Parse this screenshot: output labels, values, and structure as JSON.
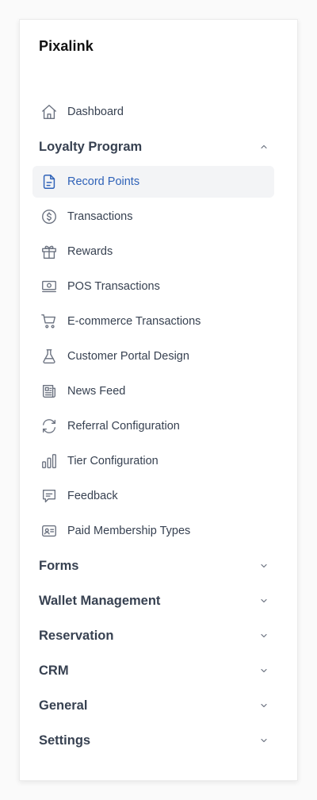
{
  "brand": "Pixalink",
  "dashboard": {
    "label": "Dashboard",
    "icon": "home-icon"
  },
  "sections": [
    {
      "label": "Loyalty Program",
      "expanded": true
    },
    {
      "label": "Forms",
      "expanded": false
    },
    {
      "label": "Wallet Management",
      "expanded": false
    },
    {
      "label": "Reservation",
      "expanded": false
    },
    {
      "label": "CRM",
      "expanded": false
    },
    {
      "label": "General",
      "expanded": false
    },
    {
      "label": "Settings",
      "expanded": false
    }
  ],
  "loyalty_items": [
    {
      "label": "Record Points",
      "icon": "document-icon",
      "active": true
    },
    {
      "label": "Transactions",
      "icon": "dollar-circle-icon"
    },
    {
      "label": "Rewards",
      "icon": "gift-icon"
    },
    {
      "label": "POS Transactions",
      "icon": "cash-icon"
    },
    {
      "label": "E-commerce Transactions",
      "icon": "cart-icon"
    },
    {
      "label": "Customer Portal Design",
      "icon": "beaker-icon"
    },
    {
      "label": "News Feed",
      "icon": "newspaper-icon"
    },
    {
      "label": "Referral Configuration",
      "icon": "refresh-icon"
    },
    {
      "label": "Tier Configuration",
      "icon": "bar-chart-icon"
    },
    {
      "label": "Feedback",
      "icon": "chat-icon"
    },
    {
      "label": "Paid Membership Types",
      "icon": "id-card-icon"
    }
  ],
  "colors": {
    "active_text": "#2f62b8",
    "active_bg": "#f3f4f6",
    "text": "#374151",
    "icon": "#6b7280"
  }
}
